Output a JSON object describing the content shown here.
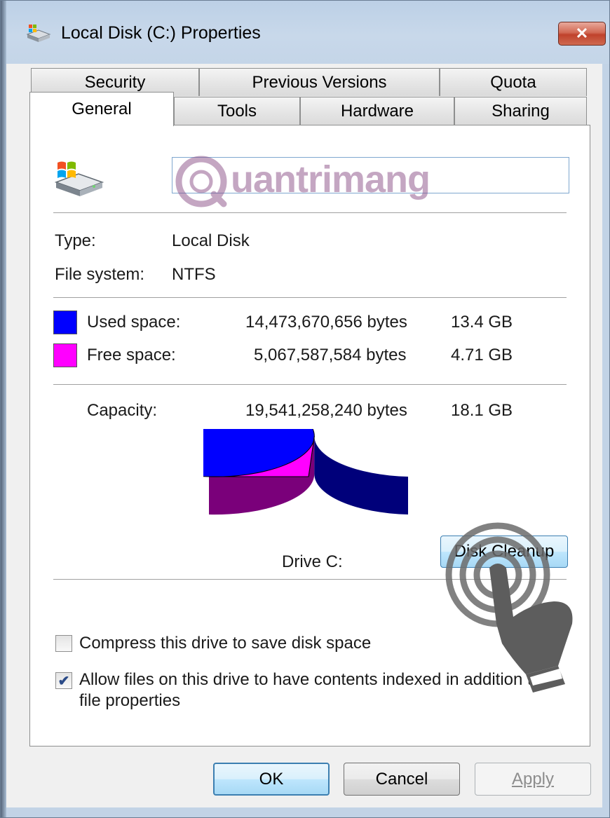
{
  "window": {
    "title": "Local Disk (C:) Properties",
    "close_label": "✕",
    "icon": "drive-icon"
  },
  "tabs": {
    "row1": [
      {
        "label": "Security"
      },
      {
        "label": "Previous Versions"
      },
      {
        "label": "Quota"
      }
    ],
    "row2": [
      {
        "label": "General",
        "active": true
      },
      {
        "label": "Tools"
      },
      {
        "label": "Hardware"
      },
      {
        "label": "Sharing"
      }
    ]
  },
  "general": {
    "drive_icon": "windows-drive-icon",
    "volume_label": "",
    "watermark_text": "uantrimang",
    "type_label": "Type:",
    "type_value": "Local Disk",
    "fs_label": "File system:",
    "fs_value": "NTFS",
    "used_label": "Used space:",
    "used_bytes": "14,473,670,656 bytes",
    "used_size": "13.4 GB",
    "free_label": "Free space:",
    "free_bytes": "5,067,587,584 bytes",
    "free_size": "4.71 GB",
    "capacity_label": "Capacity:",
    "capacity_bytes": "19,541,258,240 bytes",
    "capacity_size": "18.1 GB",
    "drive_caption": "Drive C:",
    "disk_cleanup_label": "Disk Cleanup",
    "compress_label": "Compress this drive to save disk space",
    "compress_checked": false,
    "index_label_line1": "Allow files on this drive to have contents indexed in addition to",
    "index_label_line2": "file properties",
    "index_checked": true
  },
  "colors": {
    "used": "#0000ff",
    "free": "#ff00ff",
    "used_side": "#00007a",
    "free_side": "#7a007a"
  },
  "chart_data": {
    "type": "pie",
    "categories": [
      "Used space",
      "Free space"
    ],
    "values": [
      14473670656,
      5067587584
    ]
  },
  "buttons": {
    "ok": "OK",
    "cancel": "Cancel",
    "apply": "Apply"
  }
}
